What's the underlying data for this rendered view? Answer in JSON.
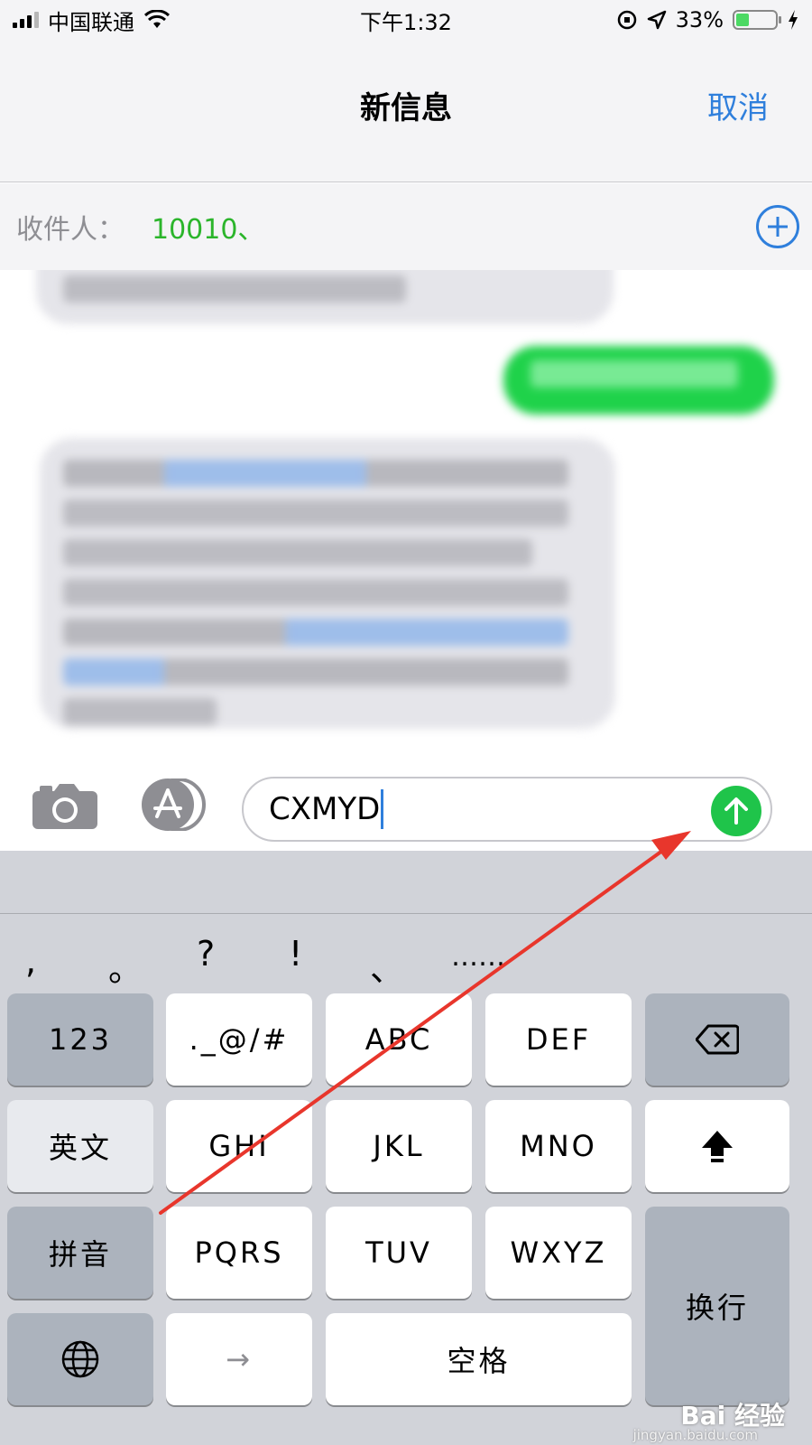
{
  "status_bar": {
    "carrier": "中国联通",
    "time": "下午1:32",
    "battery_percent": "33%",
    "battery_level": 0.33
  },
  "nav": {
    "title": "新信息",
    "cancel_label": "取消"
  },
  "recipient": {
    "label": "收件人：",
    "value": "10010、"
  },
  "conversation": {
    "blurred": true
  },
  "composer": {
    "input_value": "CXMYD"
  },
  "keyboard": {
    "punctuation": [
      ",",
      "。",
      "?",
      "!",
      "、",
      "……"
    ],
    "row1": {
      "left": "123",
      "k1": "._@/#",
      "k2": "ABC",
      "k3": "DEF",
      "right_icon": "backspace-icon"
    },
    "row2": {
      "left": "英文",
      "k1": "GHI",
      "k2": "JKL",
      "k3": "MNO",
      "right_icon": "shift-icon"
    },
    "row3": {
      "left": "拼音",
      "k1": "PQRS",
      "k2": "TUV",
      "k3": "WXYZ",
      "right": "换行"
    },
    "row4": {
      "left_icon": "globe-icon",
      "k1": "→",
      "k2": "空格"
    }
  },
  "watermark": {
    "brand": "Bai 经验",
    "url": "jingyan.baidu.com"
  },
  "colors": {
    "accent_blue": "#2f7fdc",
    "sent_green": "#1fd24a",
    "recipient_green": "#2bb52b",
    "annotation_red": "#e8362c"
  }
}
